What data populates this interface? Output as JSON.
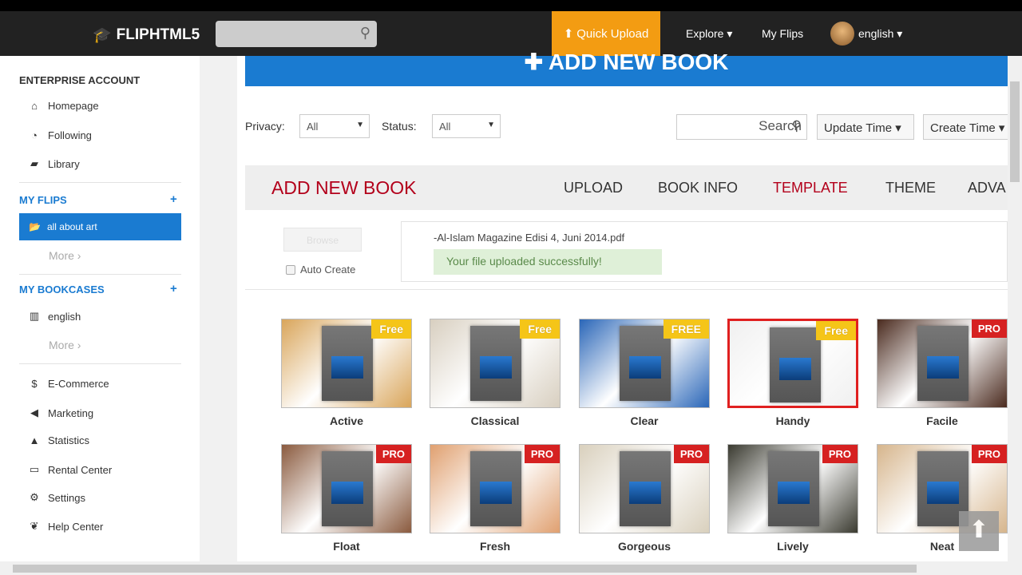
{
  "header": {
    "logo": "FLIPHTML5",
    "quick_upload": "Quick Upload",
    "explore": "Explore",
    "my_flips": "My Flips",
    "language": "english"
  },
  "sidebar": {
    "account_title": "ENTERPRISE ACCOUNT",
    "top_items": [
      {
        "label": "Homepage",
        "icon": "home-icon"
      },
      {
        "label": "Following",
        "icon": "rss-icon"
      },
      {
        "label": "Library",
        "icon": "book-icon"
      }
    ],
    "my_flips_title": "MY FLIPS",
    "my_flips_active": "all about art",
    "more": "More ›",
    "my_bookcases_title": "MY BOOKCASES",
    "bookcase": "english",
    "bottom_items": [
      {
        "label": "E-Commerce",
        "icon": "dollar-icon"
      },
      {
        "label": "Marketing",
        "icon": "megaphone-icon"
      },
      {
        "label": "Statistics",
        "icon": "chart-icon"
      },
      {
        "label": "Rental Center",
        "icon": "card-icon"
      },
      {
        "label": "Settings",
        "icon": "gear-icon"
      },
      {
        "label": "Help Center",
        "icon": "leaf-icon"
      }
    ]
  },
  "main": {
    "add_new_book_bar": "✚ ADD NEW BOOK",
    "filters": {
      "privacy_label": "Privacy:",
      "privacy_value": "All",
      "status_label": "Status:",
      "status_value": "All",
      "search_placeholder": "Search",
      "update_time": "Update Time ▾",
      "create_time": "Create Time ▾"
    },
    "panel": {
      "title": "ADD NEW BOOK",
      "tabs": [
        "UPLOAD",
        "BOOK INFO",
        "TEMPLATE",
        "THEME",
        "ADVA"
      ],
      "active_tab": "TEMPLATE",
      "browse": "Browse",
      "auto_create": "Auto Create",
      "file_name": "-Al-Islam Magazine Edisi 4, Juni 2014.pdf",
      "success": "Your file uploaded successfully!"
    },
    "templates": [
      {
        "name": "Active",
        "badge": "Free",
        "bg": "#d9a55a"
      },
      {
        "name": "Classical",
        "badge": "Free",
        "bg": "#d8cfc0"
      },
      {
        "name": "Clear",
        "badge": "FREE",
        "bg": "#2a66b8"
      },
      {
        "name": "Handy",
        "badge": "Free",
        "bg": "#f0f0f0",
        "selected": true
      },
      {
        "name": "Facile",
        "badge": "PRO",
        "bg": "#4a2a1e"
      },
      {
        "name": "Float",
        "badge": "PRO",
        "bg": "#8a5a3e"
      },
      {
        "name": "Fresh",
        "badge": "PRO",
        "bg": "#e0a070"
      },
      {
        "name": "Gorgeous",
        "badge": "PRO",
        "bg": "#d9d0bd"
      },
      {
        "name": "Lively",
        "badge": "PRO",
        "bg": "#3a3a30"
      },
      {
        "name": "Neat",
        "badge": "PRO",
        "bg": "#d6b58c"
      }
    ]
  }
}
